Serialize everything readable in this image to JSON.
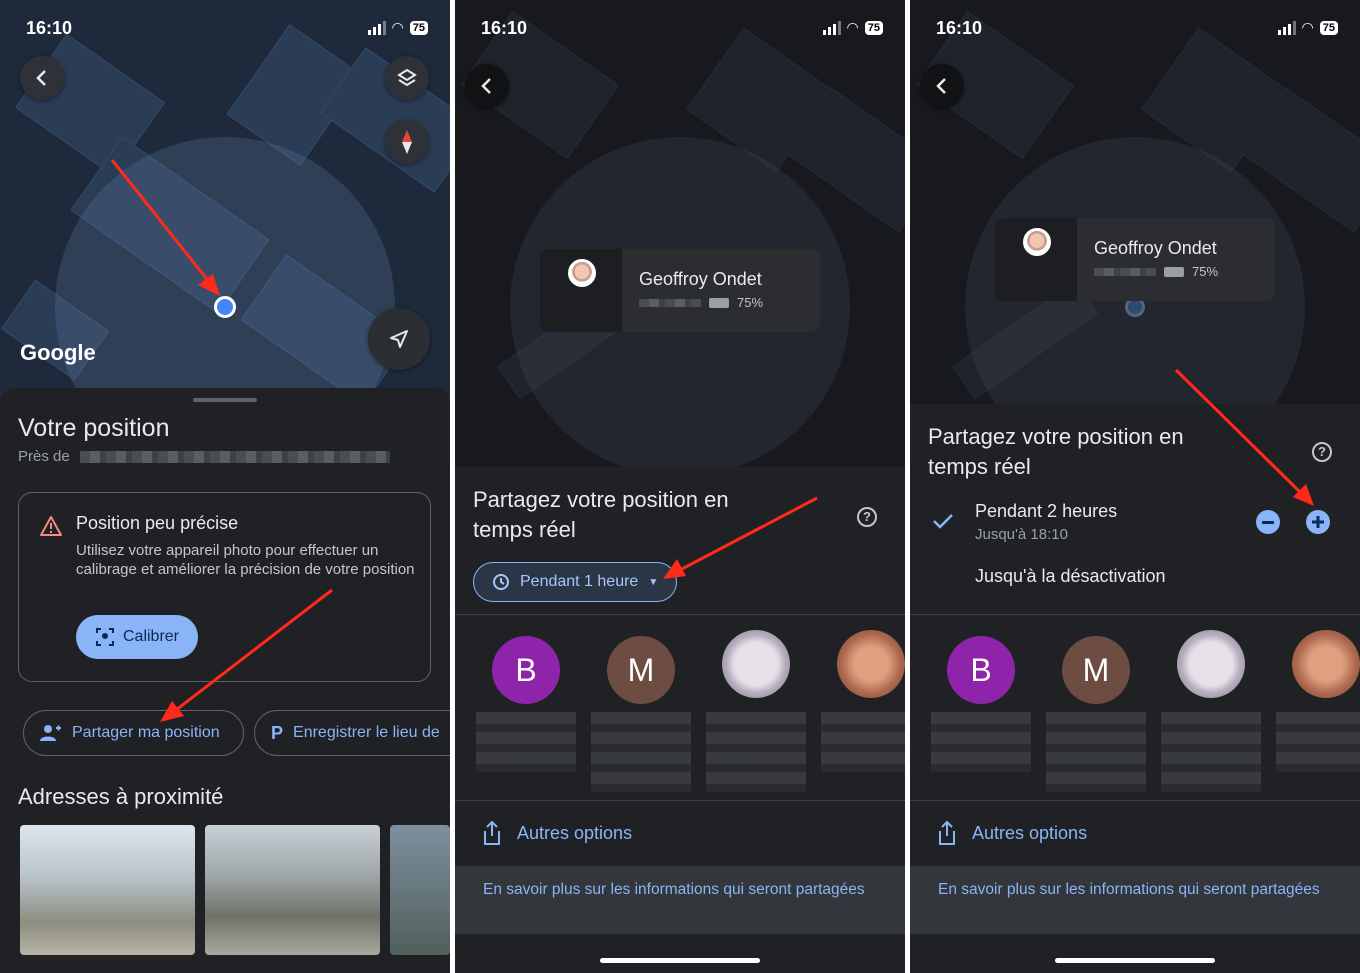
{
  "status_bar": {
    "time": "16:10",
    "battery": "75"
  },
  "panel1": {
    "map_logo": "Google",
    "title": "Votre position",
    "near_prefix": "Près de",
    "warning": {
      "title": "Position peu précise",
      "body": "Utilisez votre appareil photo pour effectuer un calibrage et améliorer la précision de votre position",
      "button": "Calibrer"
    },
    "chips": [
      "Partager ma position",
      "Enregistrer le lieu de"
    ],
    "nearby_title": "Adresses à proximité"
  },
  "panel2": {
    "person": {
      "name": "Geoffroy Ondet",
      "battery": "75%"
    },
    "title": "Partagez votre position en temps réel",
    "duration_chip": "Pendant 1 heure",
    "contacts": [
      {
        "initial": "B",
        "color": "#8e24aa"
      },
      {
        "initial": "M",
        "color": "#6d4c41"
      },
      {
        "initial": "",
        "color": "#d8d8d8"
      },
      {
        "initial": "",
        "color": "#c98a6a"
      }
    ],
    "other_options": "Autres options",
    "learn_more": "En savoir plus sur les informations qui seront partagées"
  },
  "panel3": {
    "person": {
      "name": "Geoffroy Ondet",
      "battery": "75%"
    },
    "title": "Partagez votre position en temps réel",
    "option_selected": {
      "label": "Pendant 2 heures",
      "sub": "Jusqu'à 18:10"
    },
    "option_until_off": "Jusqu'à la désactivation",
    "contacts": [
      {
        "initial": "B",
        "color": "#8e24aa"
      },
      {
        "initial": "M",
        "color": "#6d4c41"
      },
      {
        "initial": "",
        "color": "#d8d8d8"
      },
      {
        "initial": "",
        "color": "#c98a6a"
      }
    ],
    "other_options": "Autres options",
    "learn_more": "En savoir plus sur les informations qui seront partagées"
  },
  "colors": {
    "accent": "#8ab4f8",
    "annotation_arrow": "#ff2a1a",
    "location_dot": "#4285f4"
  },
  "icons": [
    "back-icon",
    "layers-icon",
    "compass-icon",
    "navigate-icon",
    "warning-icon",
    "camera-calibrate-icon",
    "share-people-icon",
    "parking-icon",
    "clock-icon",
    "help-icon",
    "check-icon",
    "minus-icon",
    "plus-icon",
    "share-icon"
  ]
}
